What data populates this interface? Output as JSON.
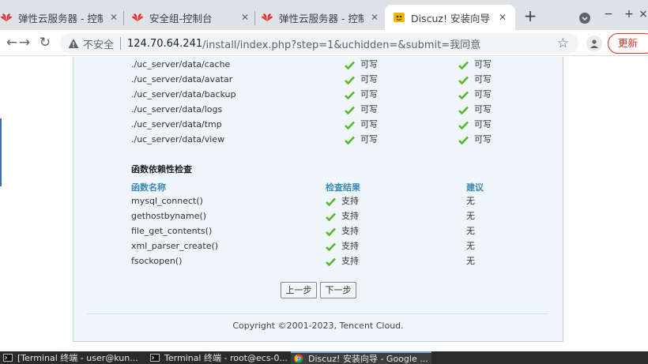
{
  "browser": {
    "tabs": [
      {
        "title": "弹性云服务器 - 控制台",
        "icon": "huawei-cloud-icon",
        "active": false
      },
      {
        "title": "安全组-控制台",
        "icon": "huawei-cloud-icon",
        "active": false
      },
      {
        "title": "弹性云服务器 - 控制台",
        "icon": "huawei-cloud-icon",
        "active": false
      },
      {
        "title": "Discuz! 安装向导",
        "icon": "discuz-icon",
        "active": true
      }
    ],
    "new_tab_label": "+",
    "minimize_label": "−",
    "maximize_label": "+",
    "close_label": "×",
    "address": {
      "security_label": "不安全",
      "host": "124.70.64.241",
      "path": "/install/index.php?step=1&uchidden=&submit=我同意"
    },
    "update_label": "更新",
    "accent_color": "#d93025"
  },
  "page": {
    "dir_rows": [
      {
        "path": "./uc_server/data/cache",
        "current": "可写",
        "required": "可写"
      },
      {
        "path": "./uc_server/data/avatar",
        "current": "可写",
        "required": "可写"
      },
      {
        "path": "./uc_server/data/backup",
        "current": "可写",
        "required": "可写"
      },
      {
        "path": "./uc_server/data/logs",
        "current": "可写",
        "required": "可写"
      },
      {
        "path": "./uc_server/data/tmp",
        "current": "可写",
        "required": "可写"
      },
      {
        "path": "./uc_server/data/view",
        "current": "可写",
        "required": "可写"
      }
    ],
    "func_section_title": "函数依赖性检查",
    "func_headers": {
      "name": "函数名称",
      "result": "检查结果",
      "suggestion": "建议"
    },
    "func_rows": [
      {
        "name": "mysql_connect()",
        "result": "支持",
        "suggestion": "无"
      },
      {
        "name": "gethostbyname()",
        "result": "支持",
        "suggestion": "无"
      },
      {
        "name": "file_get_contents()",
        "result": "支持",
        "suggestion": "无"
      },
      {
        "name": "xml_parser_create()",
        "result": "支持",
        "suggestion": "无"
      },
      {
        "name": "fsockopen()",
        "result": "支持",
        "suggestion": "无"
      }
    ],
    "prev_button": "上一步",
    "next_button": "下一步",
    "copyright": "Copyright ©2001-2023, Tencent Cloud.",
    "check_color": "#5cb531",
    "header_color": "#3d8ab4"
  },
  "taskbar": {
    "items": [
      {
        "title": "[Terminal 终端 - user@kun...",
        "icon": "terminal-icon",
        "active": false
      },
      {
        "title": "Terminal 终端 - root@ecs-0...",
        "icon": "terminal-icon",
        "active": false
      },
      {
        "title": "Discuz! 安装向导 - Google ...",
        "icon": "chrome-icon",
        "active": true
      }
    ]
  }
}
